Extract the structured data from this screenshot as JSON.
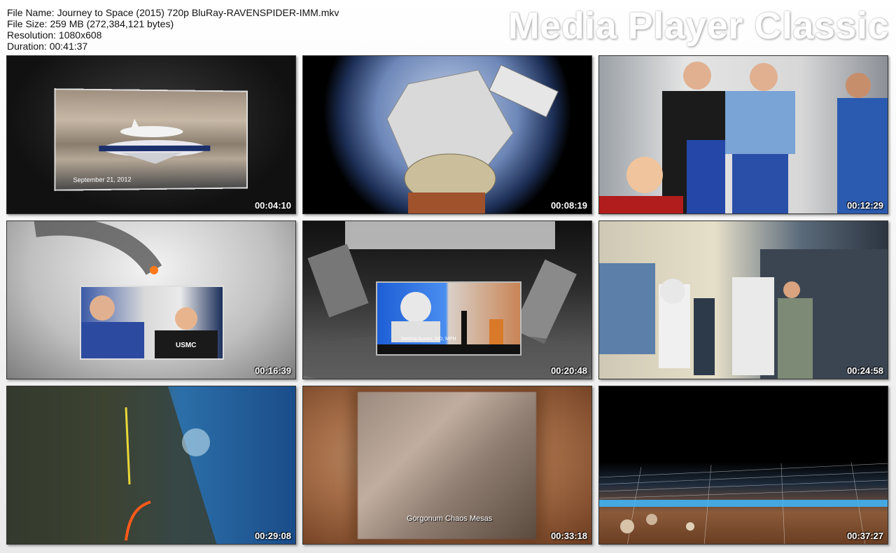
{
  "info": {
    "file_name": "File Name: Journey to Space (2015) 720p BluRay-RAVENSPIDER-IMM.mkv",
    "file_size": "File Size: 259 MB (272,384,121 bytes)",
    "resolution": "Resolution: 1080x608",
    "duration": "Duration: 00:41:37"
  },
  "brand": "Media Player Classic",
  "thumbnails": [
    {
      "timestamp": "00:04:10",
      "caption": "September 21, 2012"
    },
    {
      "timestamp": "00:08:19"
    },
    {
      "timestamp": "00:12:29"
    },
    {
      "timestamp": "00:16:39"
    },
    {
      "timestamp": "00:20:48",
      "caption": "Serena Aunon, MD, MPH"
    },
    {
      "timestamp": "00:24:58"
    },
    {
      "timestamp": "00:29:08"
    },
    {
      "timestamp": "00:33:18",
      "caption": "Gorgonum Chaos Mesas"
    },
    {
      "timestamp": "00:37:27"
    }
  ]
}
